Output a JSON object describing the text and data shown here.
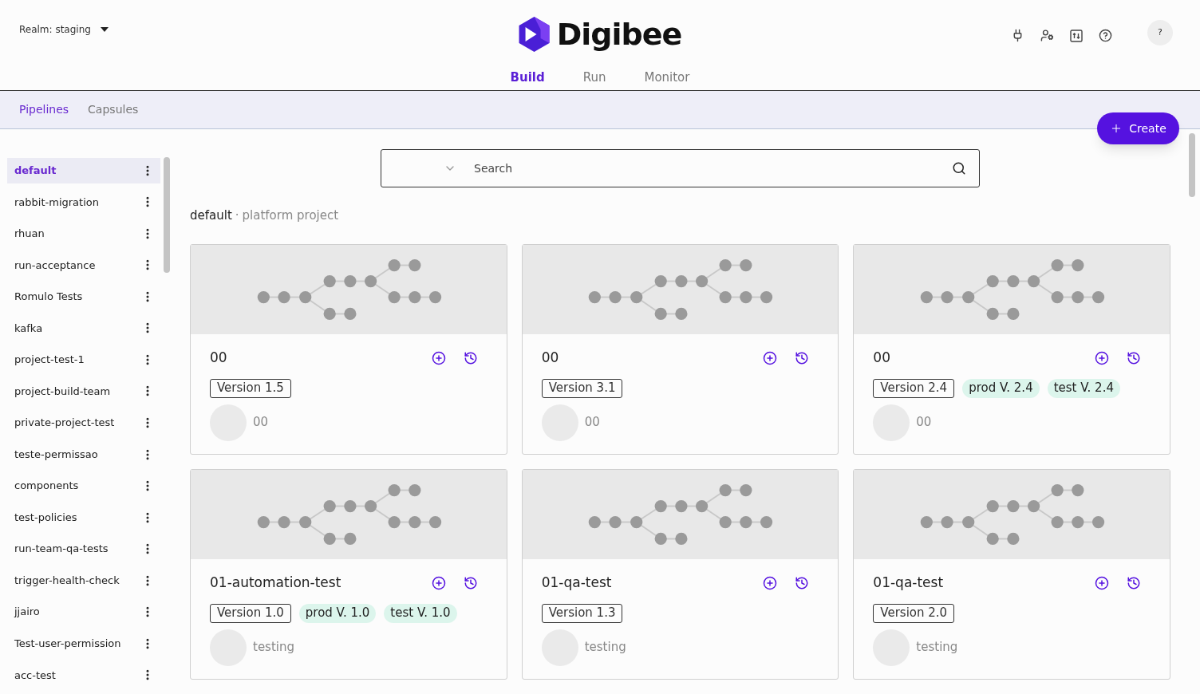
{
  "header": {
    "realm": "Realm: staging",
    "logo": "Digibee",
    "nav": [
      {
        "label": "Build",
        "selected": true
      },
      {
        "label": "Run",
        "selected": false
      },
      {
        "label": "Monitor",
        "selected": false
      }
    ],
    "avatar": "?"
  },
  "subnav": [
    {
      "label": "Pipelines",
      "selected": true
    },
    {
      "label": "Capsules",
      "selected": false
    }
  ],
  "create_button": "Create",
  "sidebar": {
    "projects": [
      {
        "label": "default",
        "selected": true
      },
      {
        "label": "rabbit-migration",
        "selected": false
      },
      {
        "label": "rhuan",
        "selected": false
      },
      {
        "label": "run-acceptance",
        "selected": false
      },
      {
        "label": "Romulo Tests",
        "selected": false
      },
      {
        "label": "kafka",
        "selected": false
      },
      {
        "label": "project-test-1",
        "selected": false
      },
      {
        "label": "project-build-team",
        "selected": false
      },
      {
        "label": "private-project-test",
        "selected": false
      },
      {
        "label": "teste-permissao",
        "selected": false
      },
      {
        "label": "components",
        "selected": false
      },
      {
        "label": "test-policies",
        "selected": false
      },
      {
        "label": "run-team-qa-tests",
        "selected": false
      },
      {
        "label": "trigger-health-check",
        "selected": false
      },
      {
        "label": "jjairo",
        "selected": false
      },
      {
        "label": "Test-user-permission",
        "selected": false
      },
      {
        "label": "acc-test",
        "selected": false
      }
    ]
  },
  "search": {
    "placeholder": "Search"
  },
  "breadcrumb": {
    "project": "default",
    "separator": "·",
    "description": "platform project"
  },
  "cards": [
    {
      "title": "00",
      "tags": [
        {
          "kind": "version",
          "label": "Version 1.5"
        }
      ],
      "owner": "00"
    },
    {
      "title": "00",
      "tags": [
        {
          "kind": "version",
          "label": "Version 3.1"
        }
      ],
      "owner": "00"
    },
    {
      "title": "00",
      "tags": [
        {
          "kind": "version",
          "label": "Version 2.4"
        },
        {
          "kind": "deployment",
          "label": "prod V. 2.4"
        },
        {
          "kind": "deployment",
          "label": "test V. 2.4"
        }
      ],
      "owner": "00"
    },
    {
      "title": "01-automation-test",
      "tags": [
        {
          "kind": "version",
          "label": "Version 1.0"
        },
        {
          "kind": "deployment",
          "label": "prod V. 1.0"
        },
        {
          "kind": "deployment",
          "label": "test V. 1.0"
        }
      ],
      "owner": "testing"
    },
    {
      "title": "01-qa-test",
      "tags": [
        {
          "kind": "version",
          "label": "Version 1.3"
        }
      ],
      "owner": "testing"
    },
    {
      "title": "01-qa-test",
      "tags": [
        {
          "kind": "version",
          "label": "Version 2.0"
        }
      ],
      "owner": "testing"
    }
  ]
}
